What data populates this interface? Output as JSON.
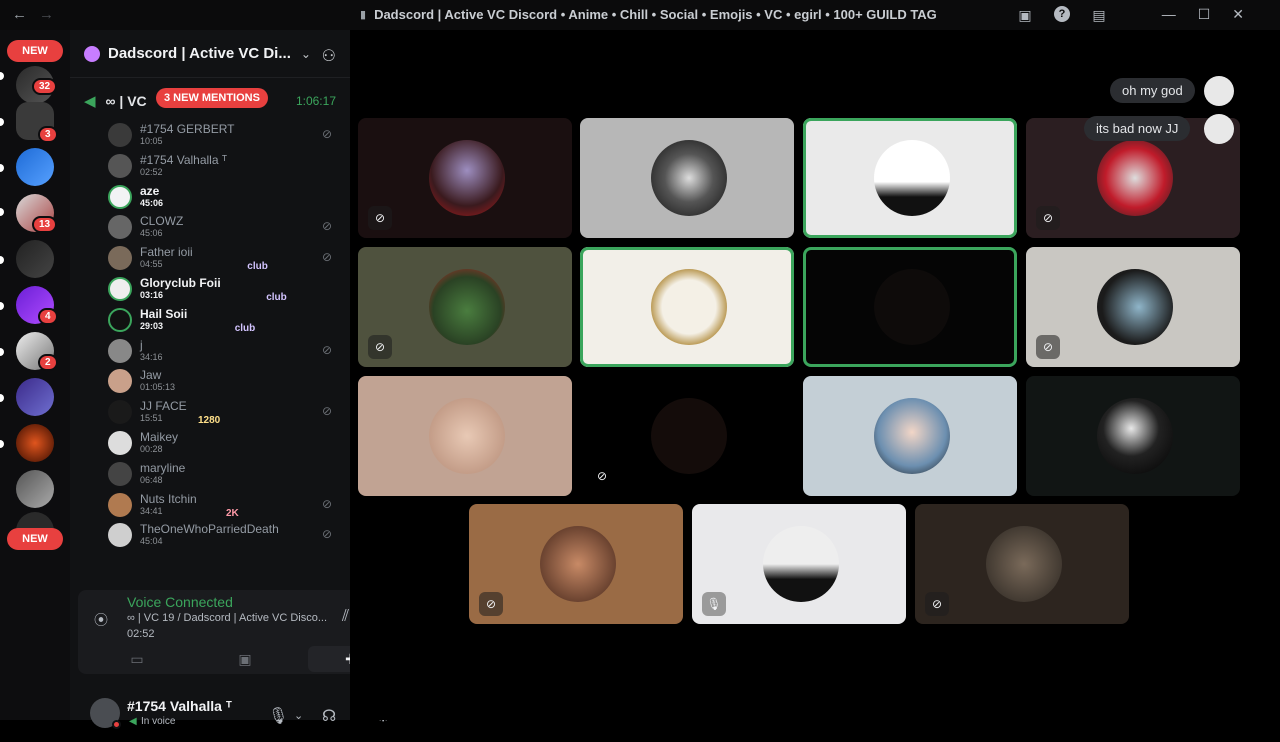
{
  "window": {
    "title": "Dadscord | Active VC Discord • Anime • Chill • Social • Emojis • VC • egirl • 100+ GUILD TAG",
    "back_icon": "arrow-left-icon",
    "forward_icon": "arrow-right-icon"
  },
  "server_rail": {
    "top_new_label": "NEW",
    "bottom_new_label": "NEW",
    "badges": [
      "32",
      "3",
      "13",
      "4",
      "2"
    ]
  },
  "guild": {
    "name": "Dadscord | Active VC Di...",
    "voice_channel_prefix": "∞ | VC",
    "mentions_label": "3 NEW MENTIONS",
    "channel_timer": "1:06:17"
  },
  "members": [
    {
      "name": "#1754 GERBERT",
      "time": "10:05",
      "muted": true,
      "bright": false,
      "tag": ""
    },
    {
      "name": "#1754 Valhalla ᵀ",
      "time": "02:52",
      "muted": false,
      "bright": false,
      "tag": ""
    },
    {
      "name": "aze",
      "time": "45:06",
      "muted": false,
      "bright": true,
      "tag": ""
    },
    {
      "name": "CLOWZ",
      "time": "45:06",
      "muted": true,
      "bright": false,
      "tag": ""
    },
    {
      "name": "Father ioii",
      "time": "04:55",
      "muted": true,
      "bright": false,
      "tag": "club"
    },
    {
      "name": "Gloryclub Foii",
      "time": "03:16",
      "muted": false,
      "bright": true,
      "tag": "club"
    },
    {
      "name": "Hail Soii",
      "time": "29:03",
      "muted": false,
      "bright": true,
      "tag": "club"
    },
    {
      "name": "j",
      "time": "34:16",
      "muted": true,
      "bright": false,
      "tag": ""
    },
    {
      "name": "Jaw",
      "time": "01:05:13",
      "muted": false,
      "bright": false,
      "tag": ""
    },
    {
      "name": "JJ FACE",
      "time": "15:51",
      "muted": true,
      "bright": false,
      "tag": "1280"
    },
    {
      "name": "Maikey",
      "time": "00:28",
      "muted": false,
      "bright": false,
      "tag": ""
    },
    {
      "name": "maryline",
      "time": "06:48",
      "muted": false,
      "bright": false,
      "tag": ""
    },
    {
      "name": "Nuts Itchin",
      "time": "34:41",
      "muted": true,
      "bright": false,
      "tag": "2K"
    },
    {
      "name": "TheOneWhoParriedDeath",
      "time": "45:04",
      "muted": true,
      "bright": false,
      "tag": ""
    }
  ],
  "voice_panel": {
    "status": "Voice Connected",
    "channel": "∞ | VC 19 / Dadscord | Active VC Disco...",
    "elapsed": "02:52"
  },
  "user": {
    "name": "#1754 Valhalla ᵀ",
    "status": "In voice"
  },
  "chat_bubbles": [
    {
      "text": "oh my god"
    },
    {
      "text": "its bad now JJ"
    }
  ],
  "colors": {
    "accent_green": "#3ba55c",
    "alert_red": "#e8403f",
    "club_purple": "#d3c4ff"
  }
}
